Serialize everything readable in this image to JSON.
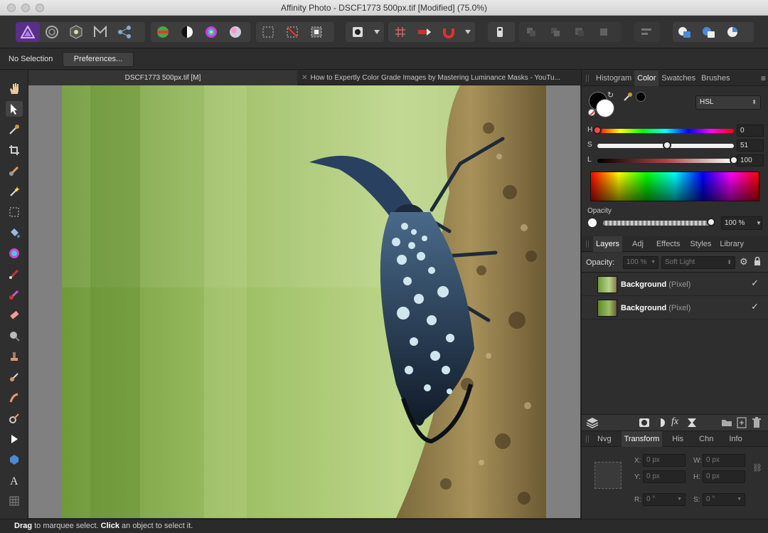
{
  "window": {
    "title": "Affinity Photo - DSCF1773 500px.tif [Modified] (75.0%)"
  },
  "context": {
    "selection": "No Selection",
    "preferences_label": "Preferences..."
  },
  "doc_tabs": [
    {
      "label": "DSCF1773 500px.tif [M]"
    },
    {
      "label": "How to Expertly Color Grade Images by Mastering Luminance Masks - YouTu..."
    }
  ],
  "color_panel": {
    "tabs": [
      "Histogram",
      "Color",
      "Swatches",
      "Brushes"
    ],
    "active_tab": "Color",
    "mode": "HSL",
    "h_label": "H",
    "s_label": "S",
    "l_label": "L",
    "h": "0",
    "s": "51",
    "l": "100",
    "h_fraction": 0.0,
    "s_fraction": 0.51,
    "l_fraction": 1.0,
    "opacity_label": "Opacity",
    "opacity": "100 %",
    "opacity_fraction": 1.0
  },
  "layers_panel": {
    "tabs": [
      "Layers",
      "Adj",
      "Effects",
      "Styles",
      "Library"
    ],
    "active_tab": "Layers",
    "opacity_label": "Opacity:",
    "opacity_value": "100 %",
    "blend_mode": "Soft Light",
    "layers": [
      {
        "name": "Background",
        "type": "(Pixel)",
        "visible": "✓"
      },
      {
        "name": "Background",
        "type": "(Pixel)",
        "visible": "✓"
      }
    ]
  },
  "transform_panel": {
    "tabs": [
      "Nvg",
      "Transform",
      "His",
      "Chn",
      "Info"
    ],
    "active_tab": "Transform",
    "x_label": "X:",
    "y_label": "Y:",
    "w_label": "W:",
    "h_label": "H:",
    "r_label": "R:",
    "s_label": "S:",
    "x": "0 px",
    "y": "0 px",
    "w": "0 px",
    "h": "0 px",
    "r": "0 °",
    "s": "0 °"
  },
  "status": {
    "drag": "Drag",
    "drag_text": " to marquee select. ",
    "click": "Click",
    "click_text": " an object to select it."
  },
  "colors": {
    "accent": "#7a2fd0",
    "panel": "#2e2e2e",
    "toolbar": "#323232"
  }
}
